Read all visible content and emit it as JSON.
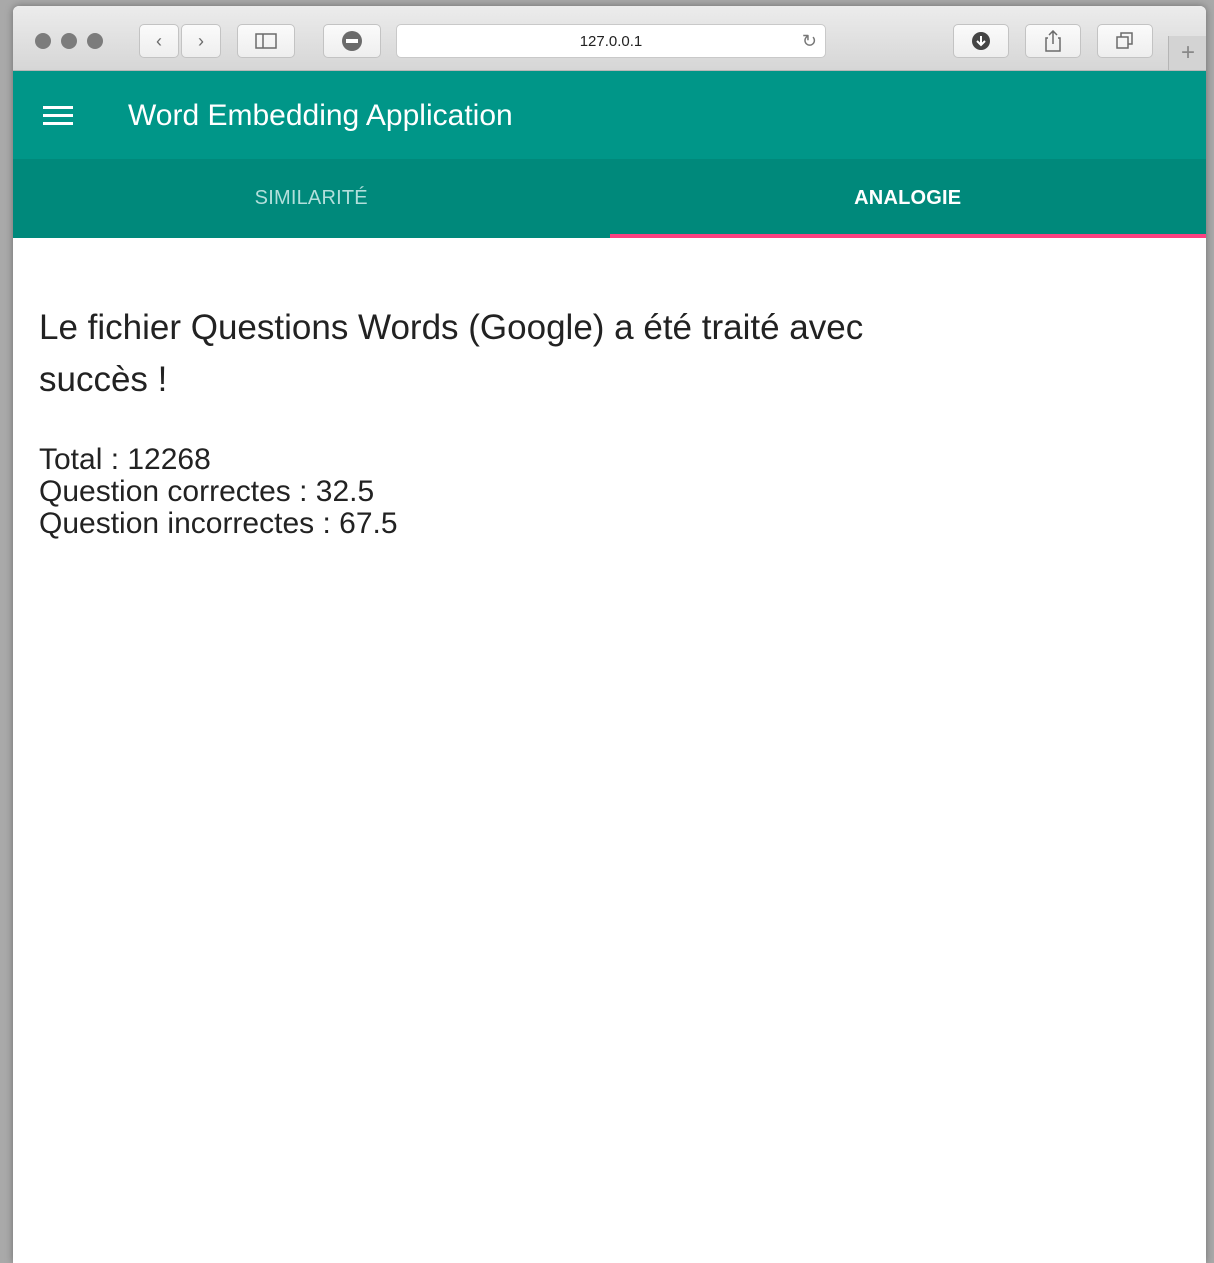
{
  "browser": {
    "url": "127.0.0.1"
  },
  "appbar": {
    "title": "Word Embedding Application"
  },
  "tabs": [
    {
      "label": "SIMILARITÉ",
      "active": false
    },
    {
      "label": "ANALOGIE",
      "active": true
    }
  ],
  "result": {
    "message": "Le fichier Questions Words (Google) a été traité avec succès !",
    "total": "Total : 12268",
    "correct": "Question correctes : 32.5",
    "incorrect": "Question incorrectes : 67.5"
  },
  "colors": {
    "primary": "#009688",
    "tabbar": "#00897b",
    "accent": "#ff4081"
  }
}
